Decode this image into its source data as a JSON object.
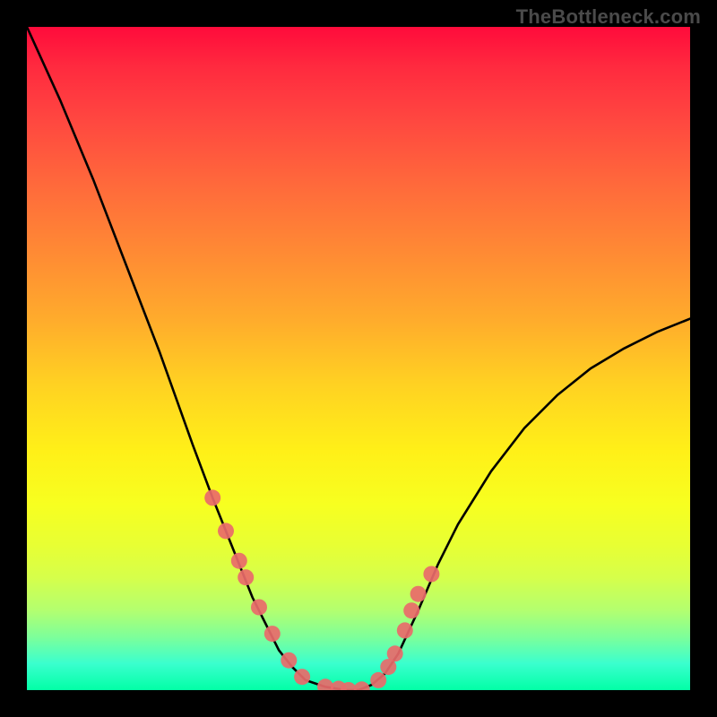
{
  "watermark": {
    "text": "TheBottleneck.com"
  },
  "chart_data": {
    "type": "line",
    "title": "",
    "xlabel": "",
    "ylabel": "",
    "xlim": [
      0,
      1
    ],
    "ylim": [
      0,
      1
    ],
    "series": [
      {
        "name": "bottleneck-curve",
        "x": [
          0.0,
          0.05,
          0.1,
          0.15,
          0.2,
          0.25,
          0.28,
          0.3,
          0.32,
          0.34,
          0.36,
          0.38,
          0.4,
          0.42,
          0.45,
          0.48,
          0.5,
          0.52,
          0.54,
          0.56,
          0.59,
          0.62,
          0.65,
          0.7,
          0.75,
          0.8,
          0.85,
          0.9,
          0.95,
          1.0
        ],
        "y": [
          1.0,
          0.89,
          0.77,
          0.64,
          0.51,
          0.37,
          0.29,
          0.24,
          0.19,
          0.14,
          0.1,
          0.06,
          0.035,
          0.015,
          0.005,
          0.0,
          0.0,
          0.008,
          0.025,
          0.055,
          0.12,
          0.19,
          0.25,
          0.33,
          0.395,
          0.445,
          0.485,
          0.515,
          0.54,
          0.56
        ]
      }
    ],
    "markers": {
      "name": "gpu-points",
      "color": "#e96a6a",
      "x": [
        0.28,
        0.3,
        0.32,
        0.33,
        0.35,
        0.37,
        0.395,
        0.415,
        0.45,
        0.47,
        0.485,
        0.505,
        0.53,
        0.545,
        0.555,
        0.57,
        0.58,
        0.59,
        0.61
      ],
      "y": [
        0.29,
        0.24,
        0.195,
        0.17,
        0.125,
        0.085,
        0.045,
        0.02,
        0.005,
        0.002,
        0.0,
        0.001,
        0.015,
        0.035,
        0.055,
        0.09,
        0.12,
        0.145,
        0.175
      ]
    }
  }
}
